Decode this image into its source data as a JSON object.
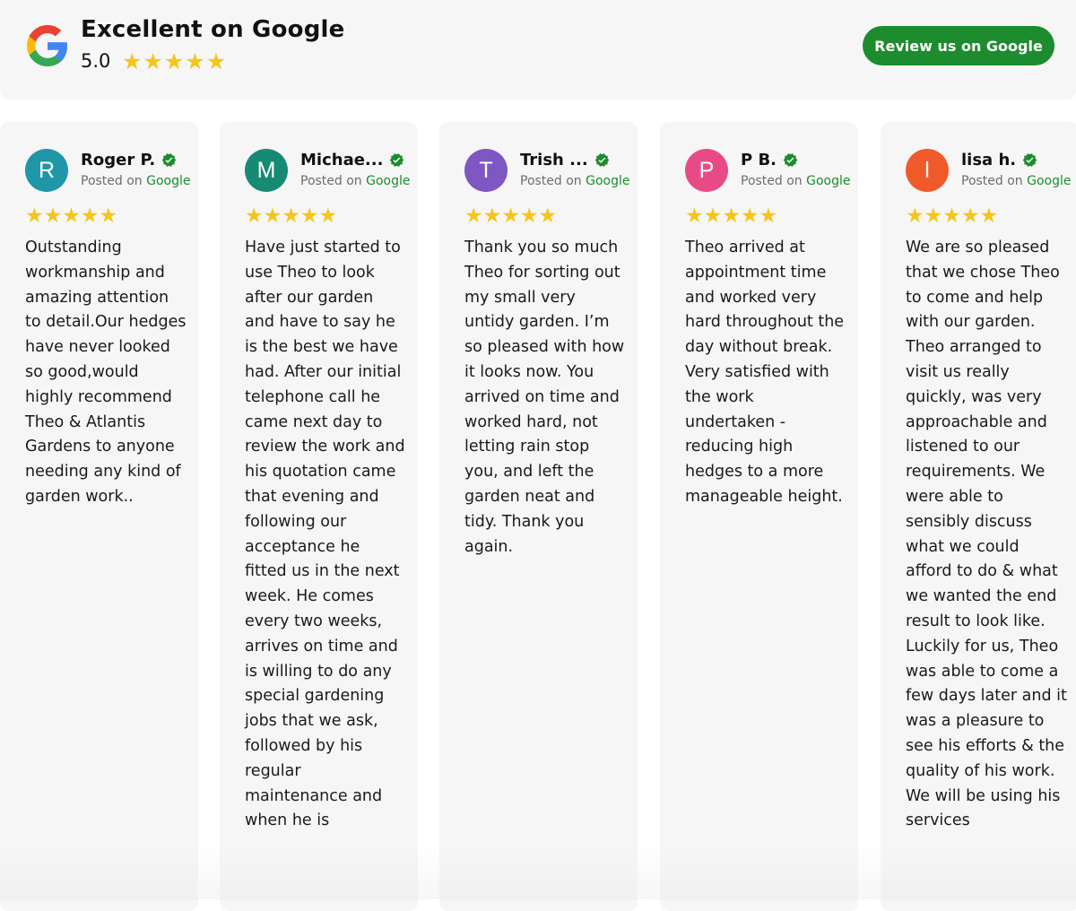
{
  "header": {
    "title": "Excellent on Google",
    "rating": "5.0",
    "stars": 5,
    "button_label": "Review us on Google"
  },
  "colors": {
    "accent_green": "#1c8c2e",
    "star_yellow": "#f4c61d"
  },
  "reviews": [
    {
      "initial": "R",
      "avatar_color": "#1f97a8",
      "name": "Roger P.",
      "posted_prefix": "Posted on",
      "posted_source": "Google",
      "stars": 5,
      "text": "Outstanding workmanship and amazing attention to detail.Our hedges have never looked so good,would highly recommend Theo & Atlantis Gardens to anyone needing any kind of garden work.."
    },
    {
      "initial": "M",
      "avatar_color": "#178a74",
      "name": "Michae...",
      "posted_prefix": "Posted on",
      "posted_source": "Google",
      "stars": 5,
      "text": "Have just started to use Theo to look after our garden and have to say he is the best we have had. After our initial telephone call he came next day to review the work and his quotation came that evening and following our acceptance he fitted us in the next week. He comes every two weeks, arrives on time and is willing to do any special gardening jobs that we ask, followed by his regular maintenance and when he is"
    },
    {
      "initial": "T",
      "avatar_color": "#7e57c2",
      "name": "Trish ...",
      "posted_prefix": "Posted on",
      "posted_source": "Google",
      "stars": 5,
      "text": "Thank you so much Theo for sorting out my small very untidy garden. I’m so pleased with how it looks now. You arrived on time and worked hard, not letting rain stop you, and left the garden neat and tidy. Thank you again."
    },
    {
      "initial": "P",
      "avatar_color": "#e84a86",
      "name": "P B.",
      "posted_prefix": "Posted on",
      "posted_source": "Google",
      "stars": 5,
      "text": "Theo arrived at appointment time and worked very hard throughout the day without break. Very satisfied with the work undertaken - reducing high hedges to a more manageable height."
    },
    {
      "initial": "l",
      "avatar_color": "#f05a2a",
      "name": "lisa h.",
      "posted_prefix": "Posted on",
      "posted_source": "Google",
      "stars": 5,
      "text": "We are so pleased that we chose Theo to come and help with our garden. Theo arranged to visit us really quickly, was very approachable and listened to our requirements. We were able to sensibly discuss what we could afford to do & what we wanted the end result to look like. Luckily for us, Theo was able to come a few days later and it was a pleasure to see his efforts & the quality of his work. We will be using his services"
    }
  ]
}
